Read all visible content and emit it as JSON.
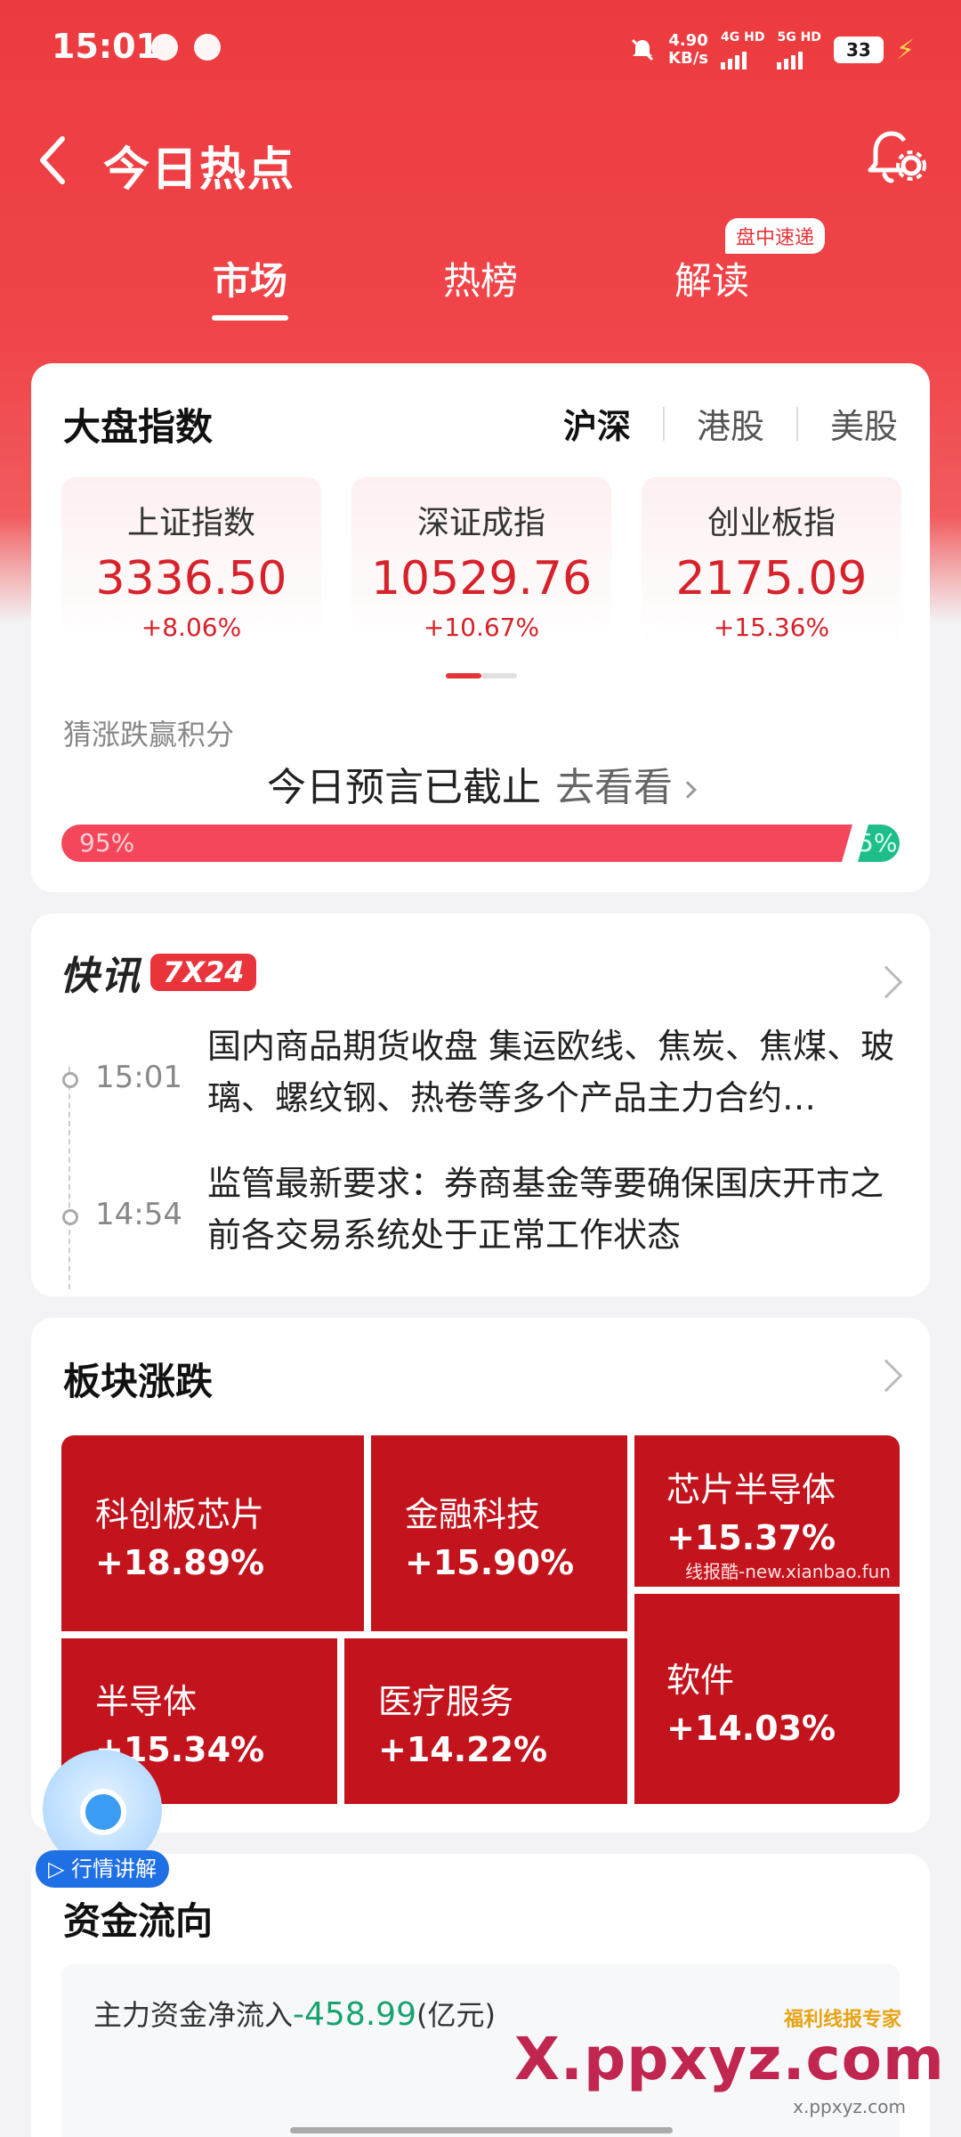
{
  "status_bar": {
    "time": "15:01",
    "net_speed_value": "4.90",
    "net_speed_unit": "KB/s",
    "net1": "4G HD",
    "net2": "5G HD",
    "battery": "33"
  },
  "header": {
    "title": "今日热点",
    "tabs": [
      {
        "label": "市场",
        "active": true
      },
      {
        "label": "热榜",
        "active": false
      },
      {
        "label": "解读",
        "active": false
      }
    ],
    "tab_badge": "盘中速递"
  },
  "index_card": {
    "title": "大盘指数",
    "markets": [
      "沪深",
      "港股",
      "美股"
    ],
    "indices": [
      {
        "name": "上证指数",
        "value": "3336.50",
        "change": "+8.06%"
      },
      {
        "name": "深证成指",
        "value": "10529.76",
        "change": "+10.67%"
      },
      {
        "name": "创业板指",
        "value": "2175.09",
        "change": "+15.36%"
      }
    ],
    "guess_label": "猜涨跌赢积分",
    "predict_text": "今日预言已截止",
    "predict_link": "去看看",
    "up_pct_label": "95%",
    "down_pct_label": "5%",
    "up_fraction": 0.95
  },
  "flash": {
    "title": "快讯",
    "badge": "7X24",
    "items": [
      {
        "time": "15:01",
        "text": "国内商品期货收盘 集运欧线、焦炭、焦煤、玻璃、螺纹钢、热卷等多个产品主力合约…"
      },
      {
        "time": "14:54",
        "text": "监管最新要求：券商基金等要确保国庆开市之前各交易系统处于正常工作状态"
      }
    ]
  },
  "sectors": {
    "title": "板块涨跌",
    "tiles": [
      {
        "name": "科创板芯片",
        "change": "+18.89%"
      },
      {
        "name": "金融科技",
        "change": "+15.90%"
      },
      {
        "name": "芯片半导体",
        "change": "+15.37%"
      },
      {
        "name": "半导体",
        "change": "+15.34%"
      },
      {
        "name": "医疗服务",
        "change": "+14.22%"
      },
      {
        "name": "软件",
        "change": "+14.03%"
      }
    ],
    "watermark": "线报酷-new.xianbao.fun"
  },
  "fund_flow": {
    "title": "资金流向",
    "label": "主力资金净流入",
    "value": "-458.99",
    "unit": "(亿元)"
  },
  "ai_float": {
    "label": "行情讲解"
  },
  "bottom_watermark": {
    "brand": "福利线报专家",
    "main": "X.ppxyz.com",
    "sub": "x.ppxyz.com"
  },
  "colors": {
    "brand_red": "#e8343a",
    "up_red": "#d7222b",
    "tile_red": "#c3141e",
    "down_green": "#1fbd8a"
  }
}
